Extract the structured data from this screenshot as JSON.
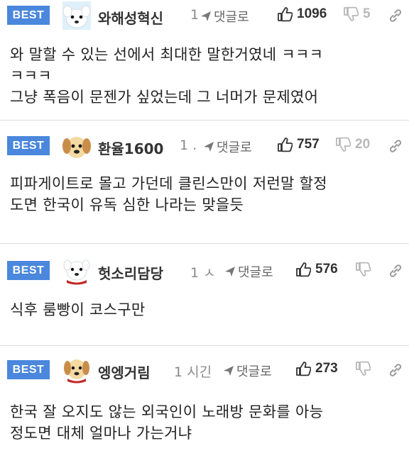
{
  "badge_label": "BEST",
  "reply_label": "댓글로",
  "comments": [
    {
      "nickname": "와해성혁신",
      "time": "1",
      "likes": "1096",
      "dislikes": "5",
      "lines": [
        "와 말할 수 있는 선에서 최대한 말한거였네 ㅋㅋㅋ",
        "ㅋㅋㅋ",
        "그냥 폭음이 문젠가 싶었는데 그 너머가 문제였어"
      ],
      "avatar": "white-puppy-icon"
    },
    {
      "nickname": "환율1600",
      "time": "1 .",
      "likes": "757",
      "dislikes": "20",
      "lines": [
        "피파게이트로 몰고 가던데 클린스만이 저런말 할정",
        "도면 한국이 유독 심한 나라는 맞을듯"
      ],
      "avatar": "golden-puppy-icon"
    },
    {
      "nickname": "헛소리담당",
      "time": "1 ㅅ",
      "likes": "576",
      "dislikes": "",
      "lines": [
        "식후 룸빵이 코스구만"
      ],
      "avatar": "white-puppy-red-collar-icon"
    },
    {
      "nickname": "엥엥거림",
      "time": "1 시긴",
      "likes": "273",
      "dislikes": "",
      "lines": [
        "한국 잘 오지도 않는 외국인이 노래방 문화를 아능",
        "정도면 대체 얼마나 가는거냐"
      ],
      "avatar": "golden-puppy-red-collar-icon"
    }
  ]
}
